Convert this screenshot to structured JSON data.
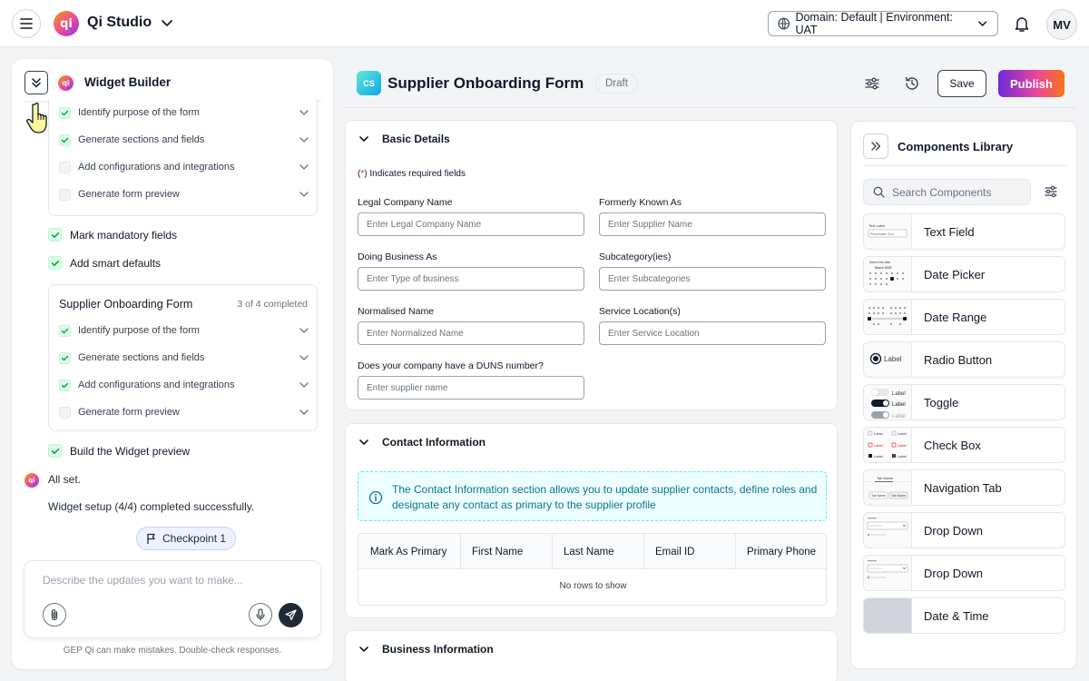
{
  "app": {
    "title": "Qi Studio",
    "logo_text": "qi",
    "avatar": "MV",
    "domain_select": "Domain: Default | Environment: UAT"
  },
  "builder": {
    "title": "Widget Builder",
    "top_steps": [
      {
        "label": "Identify purpose of the form",
        "checked": true
      },
      {
        "label": "Generate sections and fields",
        "checked": true
      },
      {
        "label": "Add configurations and integrations",
        "checked": false
      },
      {
        "label": "Generate form preview",
        "checked": false
      }
    ],
    "mark_mandatory": "Mark mandatory fields",
    "smart_defaults": "Add smart defaults",
    "supplier_box": {
      "title": "Supplier Onboarding Form",
      "count": "3 of 4 completed",
      "steps": [
        {
          "label": "Identify purpose of the form",
          "checked": true
        },
        {
          "label": "Generate sections and fields",
          "checked": true
        },
        {
          "label": "Add configurations and integrations",
          "checked": true
        },
        {
          "label": "Generate form preview",
          "checked": false
        }
      ]
    },
    "build_preview": "Build the Widget preview",
    "all_set": "All set.",
    "completed_msg": "Widget setup (4/4) completed successfully.",
    "checkpoint": "Checkpoint 1",
    "chat_placeholder": "Describe the updates you want to make...",
    "disclaimer": "GEP Qi can make mistakes. Double-check responses."
  },
  "form": {
    "badge": "CS",
    "title": "Supplier Onboarding Form",
    "status": "Draft",
    "save": "Save",
    "publish": "Publish",
    "basic": {
      "title": "Basic Details",
      "req_star": "*",
      "req_note": "Indicates required fields",
      "fields": [
        {
          "label": "Legal Company Name",
          "placeholder": "Enter Legal Company Name"
        },
        {
          "label": "Formerly Known As",
          "placeholder": "Enter Supplier Name"
        },
        {
          "label": "Doing Business As",
          "placeholder": "Enter Type of business"
        },
        {
          "label": "Subcategory(ies)",
          "placeholder": "Enter Subcategories"
        },
        {
          "label": "Normalised Name",
          "placeholder": "Enter Normalized Name"
        },
        {
          "label": "Service Location(s)",
          "placeholder": "Enter Service Location"
        },
        {
          "label": "Does your company have a DUNS number?",
          "placeholder": "Enter supplier name"
        }
      ]
    },
    "contact": {
      "title": "Contact Information",
      "info": "The Contact Information section allows you to update supplier contacts, define roles and designate any contact as primary to the supplier profile",
      "columns": [
        "Mark As Primary",
        "First Name",
        "Last Name",
        "Email ID",
        "Primary Phone"
      ],
      "empty": "No rows to show"
    },
    "business": {
      "title": "Business Information"
    }
  },
  "library": {
    "title": "Components Library",
    "search_placeholder": "Search Components",
    "items": [
      "Text Field",
      "Date Picker",
      "Date Range",
      "Radio Button",
      "Toggle",
      "Check Box",
      "Navigation Tab",
      "Drop Down",
      "Drop Down",
      "Date & Time"
    ],
    "thumb_text": {
      "text_label": "Text Label",
      "placeholder": "Placeholder Text",
      "select_date": "Select the date",
      "month": "March 2025",
      "label": "Label",
      "tab_name": "Tab Name"
    }
  }
}
